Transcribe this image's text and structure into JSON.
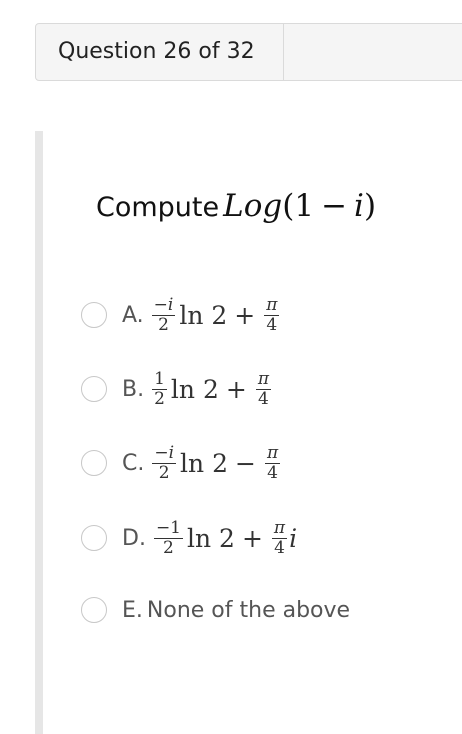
{
  "header": {
    "title": "Question 26 of 32"
  },
  "question": {
    "prompt": "Compute",
    "expr_fn": "Log",
    "expr_open": "(",
    "expr_one": "1",
    "expr_minus": "−",
    "expr_i": "i",
    "expr_close": ")"
  },
  "options": [
    {
      "letter": "A.",
      "frac1_num": "−i",
      "frac1_den": "2",
      "ln": "ln 2",
      "op": "+",
      "frac2_num": "π",
      "frac2_den": "4",
      "tail": ""
    },
    {
      "letter": "B.",
      "frac1_num": "1",
      "frac1_den": "2",
      "ln": "ln 2",
      "op": "+",
      "frac2_num": "π",
      "frac2_den": "4",
      "tail": ""
    },
    {
      "letter": "C.",
      "frac1_num": "−i",
      "frac1_den": "2",
      "ln": "ln 2",
      "op": "−",
      "frac2_num": "π",
      "frac2_den": "4",
      "tail": ""
    },
    {
      "letter": "D.",
      "frac1_num": "−1",
      "frac1_den": "2",
      "ln": "ln 2",
      "op": "+",
      "frac2_num": "π",
      "frac2_den": "4",
      "tail": "i"
    },
    {
      "letter": "E.",
      "text": "None of the above"
    }
  ]
}
